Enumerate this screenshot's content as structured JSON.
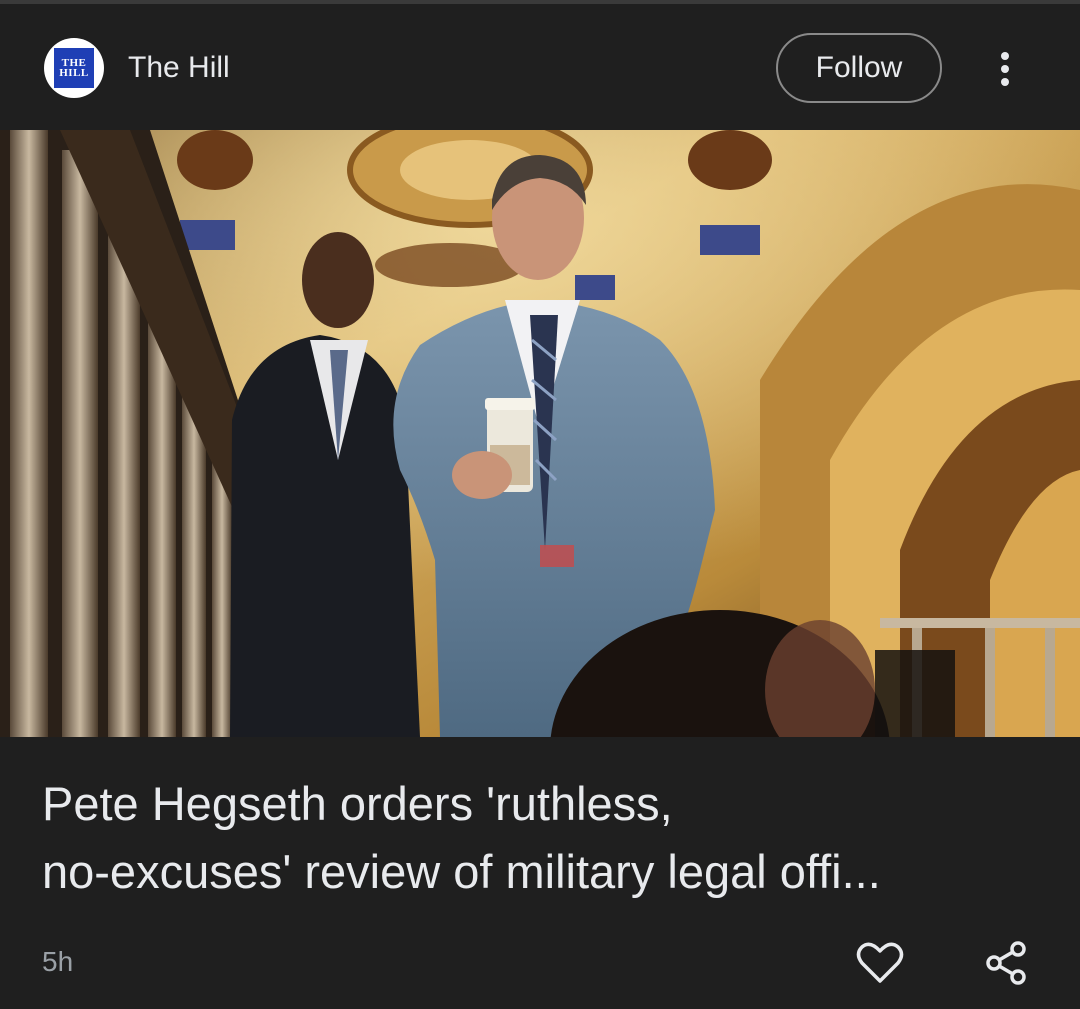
{
  "header": {
    "source_name": "The Hill",
    "logo_text_line1": "THE",
    "logo_text_line2": "HILL",
    "follow_label": "Follow",
    "more_icon": "more-vert-icon"
  },
  "article": {
    "headline_line1": "Pete Hegseth orders 'ruthless,",
    "headline_line2": "no-excuses' review of military legal offi...",
    "timestamp": "5h"
  },
  "actions": {
    "like_icon": "heart-icon",
    "share_icon": "share-icon"
  },
  "colors": {
    "background": "#1f1f1f",
    "text_primary": "#e8eaed",
    "text_secondary": "#9aa0a6",
    "logo_blue": "#1f3fb5"
  }
}
